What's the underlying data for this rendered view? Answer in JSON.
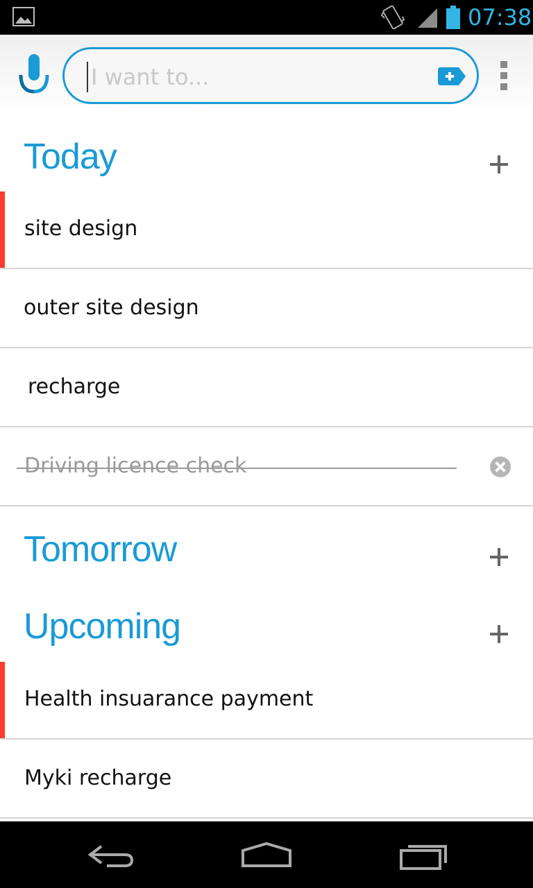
{
  "status_bar": {
    "time": "07:38",
    "icons": [
      "gallery-icon",
      "vibrate-icon",
      "signal-icon",
      "battery-icon"
    ],
    "accent_color": "#33b5e5"
  },
  "search": {
    "placeholder": "I want to...",
    "value": ""
  },
  "colors": {
    "brand": "#1a9ad6",
    "priority": "#ff3b30",
    "divider": "#d4d4d4"
  },
  "sections": {
    "today": {
      "title": "Today",
      "tasks": [
        {
          "label": "site design",
          "priority": true,
          "done": false
        },
        {
          "label": "outer site design",
          "priority": false,
          "done": false
        },
        {
          "label": "recharge",
          "priority": false,
          "done": false
        },
        {
          "label": "Driving licence check",
          "priority": false,
          "done": true
        }
      ]
    },
    "tomorrow": {
      "title": "Tomorrow",
      "tasks": []
    },
    "upcoming": {
      "title": "Upcoming",
      "tasks": [
        {
          "label": "Health insuarance payment",
          "priority": true,
          "done": false
        },
        {
          "label": "Myki recharge",
          "priority": false,
          "done": false
        }
      ]
    }
  },
  "nav_bar": {
    "icons": [
      "back-icon",
      "home-icon",
      "recent-apps-icon"
    ]
  }
}
